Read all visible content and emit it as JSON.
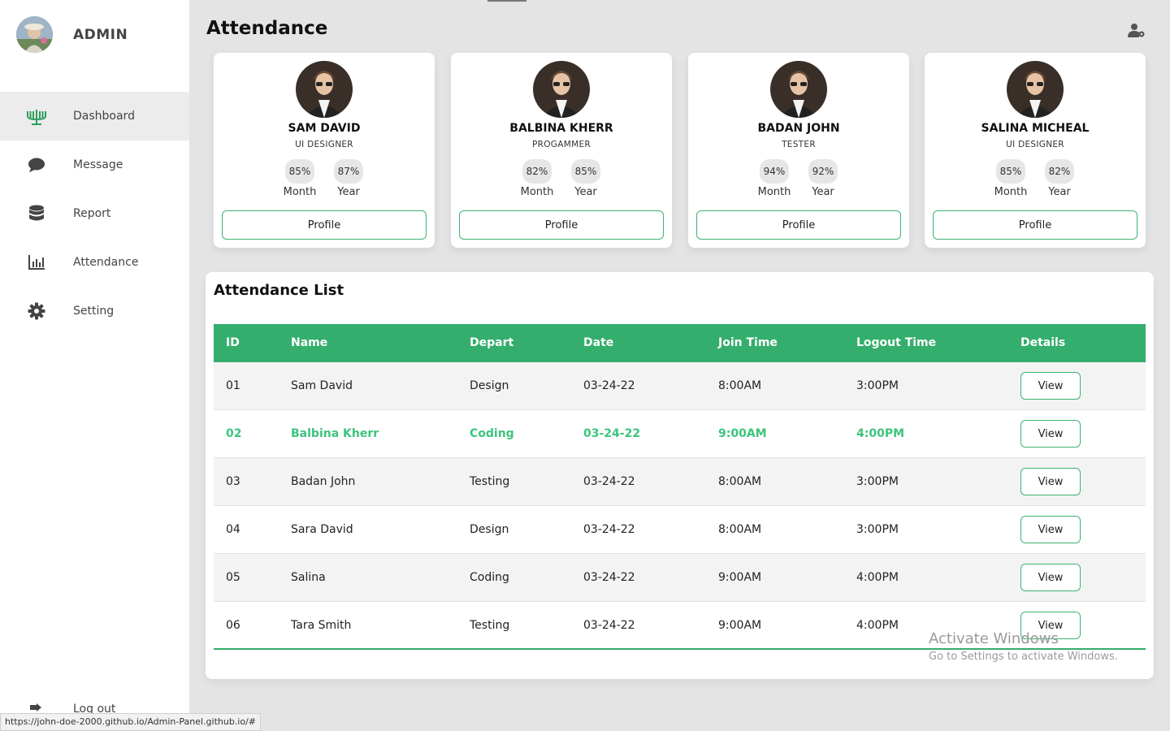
{
  "sidebar": {
    "brand": "ADMIN",
    "items": [
      {
        "label": "Dashboard",
        "icon": "candelabra-icon"
      },
      {
        "label": "Message",
        "icon": "chat-bubble-icon"
      },
      {
        "label": "Report",
        "icon": "database-icon"
      },
      {
        "label": "Attendance",
        "icon": "bar-chart-icon"
      },
      {
        "label": "Setting",
        "icon": "gear-icon"
      }
    ],
    "logout": "Log out",
    "status_url": "https://john-doe-2000.github.io/Admin-Panel.github.io/#"
  },
  "header": {
    "title": "Attendance",
    "admin_icon": "user-gear-icon"
  },
  "cards": [
    {
      "name": "SAM DAVID",
      "role": "UI DESIGNER",
      "month": "85%",
      "year": "87%",
      "month_label": "Month",
      "year_label": "Year",
      "button": "Profile"
    },
    {
      "name": "BALBINA KHERR",
      "role": "PROGAMMER",
      "month": "82%",
      "year": "85%",
      "month_label": "Month",
      "year_label": "Year",
      "button": "Profile"
    },
    {
      "name": "BADAN JOHN",
      "role": "TESTER",
      "month": "94%",
      "year": "92%",
      "month_label": "Month",
      "year_label": "Year",
      "button": "Profile"
    },
    {
      "name": "SALINA MICHEAL",
      "role": "UI DESIGNER",
      "month": "85%",
      "year": "82%",
      "month_label": "Month",
      "year_label": "Year",
      "button": "Profile"
    }
  ],
  "list": {
    "title": "Attendance List",
    "headers": [
      "ID",
      "Name",
      "Depart",
      "Date",
      "Join Time",
      "Logout Time",
      "Details"
    ],
    "rows": [
      {
        "id": "01",
        "name": "Sam David",
        "depart": "Design",
        "date": "03-24-22",
        "join": "8:00AM",
        "logout": "3:00PM",
        "details": "View"
      },
      {
        "id": "02",
        "name": "Balbina Kherr",
        "depart": "Coding",
        "date": "03-24-22",
        "join": "9:00AM",
        "logout": "4:00PM",
        "details": "View"
      },
      {
        "id": "03",
        "name": "Badan John",
        "depart": "Testing",
        "date": "03-24-22",
        "join": "8:00AM",
        "logout": "3:00PM",
        "details": "View"
      },
      {
        "id": "04",
        "name": "Sara David",
        "depart": "Design",
        "date": "03-24-22",
        "join": "8:00AM",
        "logout": "3:00PM",
        "details": "View"
      },
      {
        "id": "05",
        "name": "Salina",
        "depart": "Coding",
        "date": "03-24-22",
        "join": "9:00AM",
        "logout": "4:00PM",
        "details": "View"
      },
      {
        "id": "06",
        "name": "Tara Smith",
        "depart": "Testing",
        "date": "03-24-22",
        "join": "9:00AM",
        "logout": "4:00PM",
        "details": "View"
      }
    ]
  },
  "watermark": {
    "line1": "Activate Windows",
    "line2": "Go to Settings to activate Windows."
  },
  "colors": {
    "accent": "#34ae6c",
    "highlight_text": "#3cc47c",
    "background": "#e4e4e4"
  }
}
